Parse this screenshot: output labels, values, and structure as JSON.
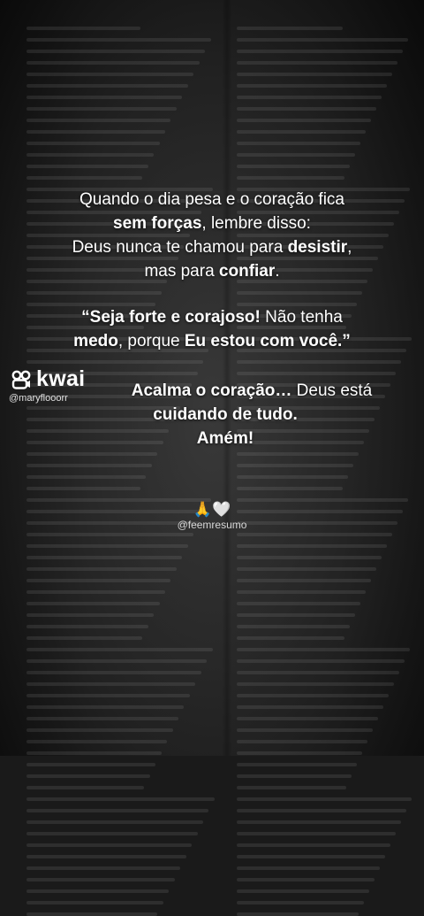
{
  "message": {
    "p1": [
      {
        "parts": [
          {
            "t": "Quando o dia pesa e o coração fica",
            "b": false
          }
        ]
      },
      {
        "parts": [
          {
            "t": "sem forças",
            "b": true
          },
          {
            "t": ", lembre disso:",
            "b": false
          }
        ]
      },
      {
        "parts": [
          {
            "t": "Deus nunca te chamou para ",
            "b": false
          },
          {
            "t": "desistir",
            "b": true
          },
          {
            "t": ",",
            "b": false
          }
        ]
      },
      {
        "parts": [
          {
            "t": "mas para ",
            "b": false
          },
          {
            "t": "confiar",
            "b": true
          },
          {
            "t": ".",
            "b": false
          }
        ]
      }
    ],
    "p2": [
      {
        "parts": [
          {
            "t": "“Seja forte e corajoso!",
            "b": true
          },
          {
            "t": " Não tenha",
            "b": false
          }
        ]
      },
      {
        "parts": [
          {
            "t": "medo",
            "b": true
          },
          {
            "t": ", porque ",
            "b": false
          },
          {
            "t": "Eu estou com você.”",
            "b": true
          }
        ]
      }
    ],
    "p3": [
      {
        "parts": [
          {
            "t": "Acalma o coração…",
            "b": true
          },
          {
            "t": " Deus está",
            "b": false
          }
        ]
      },
      {
        "parts": [
          {
            "t": "cuidando de tudo.",
            "b": true
          }
        ]
      },
      {
        "parts": [
          {
            "t": "Amém!",
            "b": true
          }
        ]
      }
    ],
    "emoji": "🙏🤍",
    "credit": "@feemresumo"
  },
  "watermark": {
    "brand": "kwai",
    "user": "@maryflooorr",
    "icon": "kwai-logo-icon"
  }
}
